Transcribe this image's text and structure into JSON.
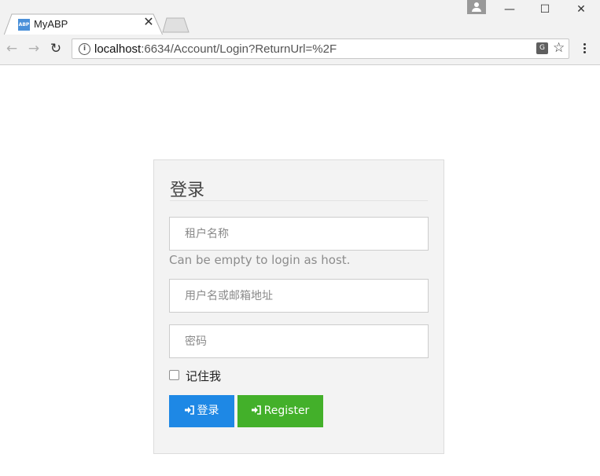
{
  "browser": {
    "tab_title": "MyABP",
    "favicon_text": "ABP",
    "url_host": "localhost",
    "url_rest": ":6634/Account/Login?ReturnUrl=%2F"
  },
  "login": {
    "title": "登录",
    "tenant_placeholder": "租户名称",
    "tenant_help": "Can be empty to login as host.",
    "username_placeholder": "用户名或邮箱地址",
    "password_placeholder": "密码",
    "remember_label": "记住我",
    "remember_checked": false,
    "login_button": "登录",
    "register_button": "Register"
  },
  "colors": {
    "login_button": "#1e88e5",
    "register_button": "#43b02a",
    "panel_background": "#f3f3f3"
  }
}
